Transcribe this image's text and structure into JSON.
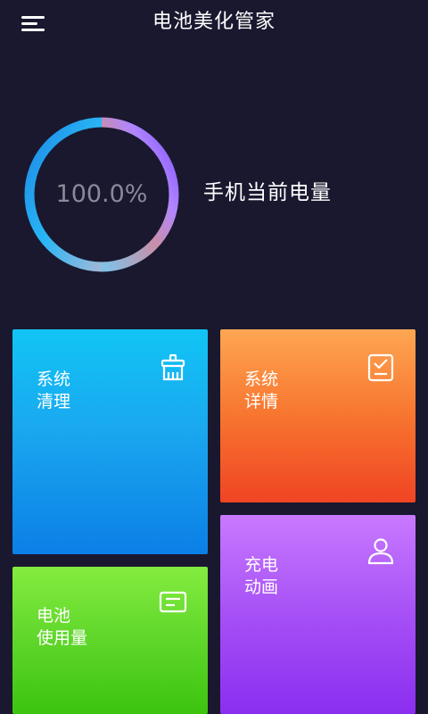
{
  "header": {
    "title": "电池美化管家",
    "menu_icon": "hamburger-menu-icon"
  },
  "battery": {
    "percent_text": "100.0%",
    "level_fraction": 1.0,
    "label": "手机当前电量",
    "ring_colors": [
      "#7c4dff",
      "#b085ff",
      "#c98fa8",
      "#7ec4e8",
      "#28b6f6",
      "#1e88e5"
    ]
  },
  "tiles": {
    "clean": {
      "line1": "系统",
      "line2": "清理",
      "icon": "broom-icon",
      "color_top": "#11c5f5",
      "color_bottom": "#0b7fe6"
    },
    "detail": {
      "line1": "系统",
      "line2": "详情",
      "icon": "checklist-icon",
      "color_top": "#ffa652",
      "color_bottom": "#f04423"
    },
    "usage": {
      "line1": "电池",
      "line2": "使用量",
      "icon": "message-card-icon",
      "color_top": "#84ec3f",
      "color_bottom": "#3cc40f"
    },
    "anim": {
      "line1": "充电",
      "line2": "动画",
      "icon": "user-icon",
      "color_top": "#c879ff",
      "color_bottom": "#8b2ef0"
    }
  },
  "colors": {
    "background": "#19182f",
    "text": "#ffffff",
    "percent_text": "#8a8a9a"
  }
}
